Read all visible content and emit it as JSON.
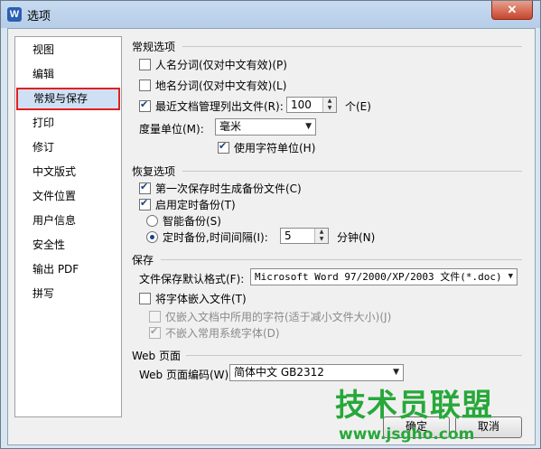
{
  "window": {
    "title": "选项",
    "close_glyph": "✕",
    "app_icon_letter": "W"
  },
  "sidebar": {
    "items": [
      {
        "label": "视图"
      },
      {
        "label": "编辑"
      },
      {
        "label": "常规与保存",
        "selected": true
      },
      {
        "label": "打印"
      },
      {
        "label": "修订"
      },
      {
        "label": "中文版式"
      },
      {
        "label": "文件位置"
      },
      {
        "label": "用户信息"
      },
      {
        "label": "安全性"
      },
      {
        "label": "输出 PDF"
      },
      {
        "label": "拼写"
      }
    ]
  },
  "general": {
    "heading": "常规选项",
    "name_segment": {
      "label": "人名分词(仅对中文有效)(P)",
      "checked": false
    },
    "place_segment": {
      "label": "地名分词(仅对中文有效)(L)",
      "checked": false
    },
    "recent_files": {
      "label": "最近文档管理列出文件(R):",
      "checked": true,
      "value": "100",
      "unit": "个(E)"
    },
    "measure_unit": {
      "label": "度量单位(M):",
      "value": "毫米"
    },
    "char_unit": {
      "label": "使用字符单位(H)",
      "checked": true
    }
  },
  "recovery": {
    "heading": "恢复选项",
    "first_backup": {
      "label": "第一次保存时生成备份文件(C)",
      "checked": true
    },
    "timed_backup": {
      "label": "启用定时备份(T)",
      "checked": true
    },
    "smart_backup": {
      "label": "智能备份(S)",
      "selected": false
    },
    "interval_backup": {
      "label": "定时备份,时间间隔(I):",
      "selected": true,
      "value": "5",
      "unit": "分钟(N)"
    }
  },
  "save": {
    "heading": "保存",
    "default_format": {
      "label": "文件保存默认格式(F):",
      "value": "Microsoft Word 97/2000/XP/2003 文件(*.doc)"
    },
    "embed_fonts": {
      "label": "将字体嵌入文件(T)",
      "checked": false
    },
    "embed_used_chars": {
      "label": "仅嵌入文档中所用的字符(适于减小文件大小)(J)",
      "checked": false
    },
    "no_embed_common": {
      "label": "不嵌入常用系统字体(D)",
      "checked": true
    }
  },
  "web": {
    "heading": "Web 页面",
    "encoding": {
      "label": "Web 页面编码(W):",
      "value": "简体中文 GB2312"
    }
  },
  "footer": {
    "ok_label": "确定",
    "cancel_label": "取消"
  },
  "watermark": {
    "title": "技术员联盟",
    "url": "www.jsgho.com"
  },
  "colors": {
    "accent": "#1c3f8a",
    "selection_outline": "#e02020",
    "watermark": "#27a83a"
  }
}
